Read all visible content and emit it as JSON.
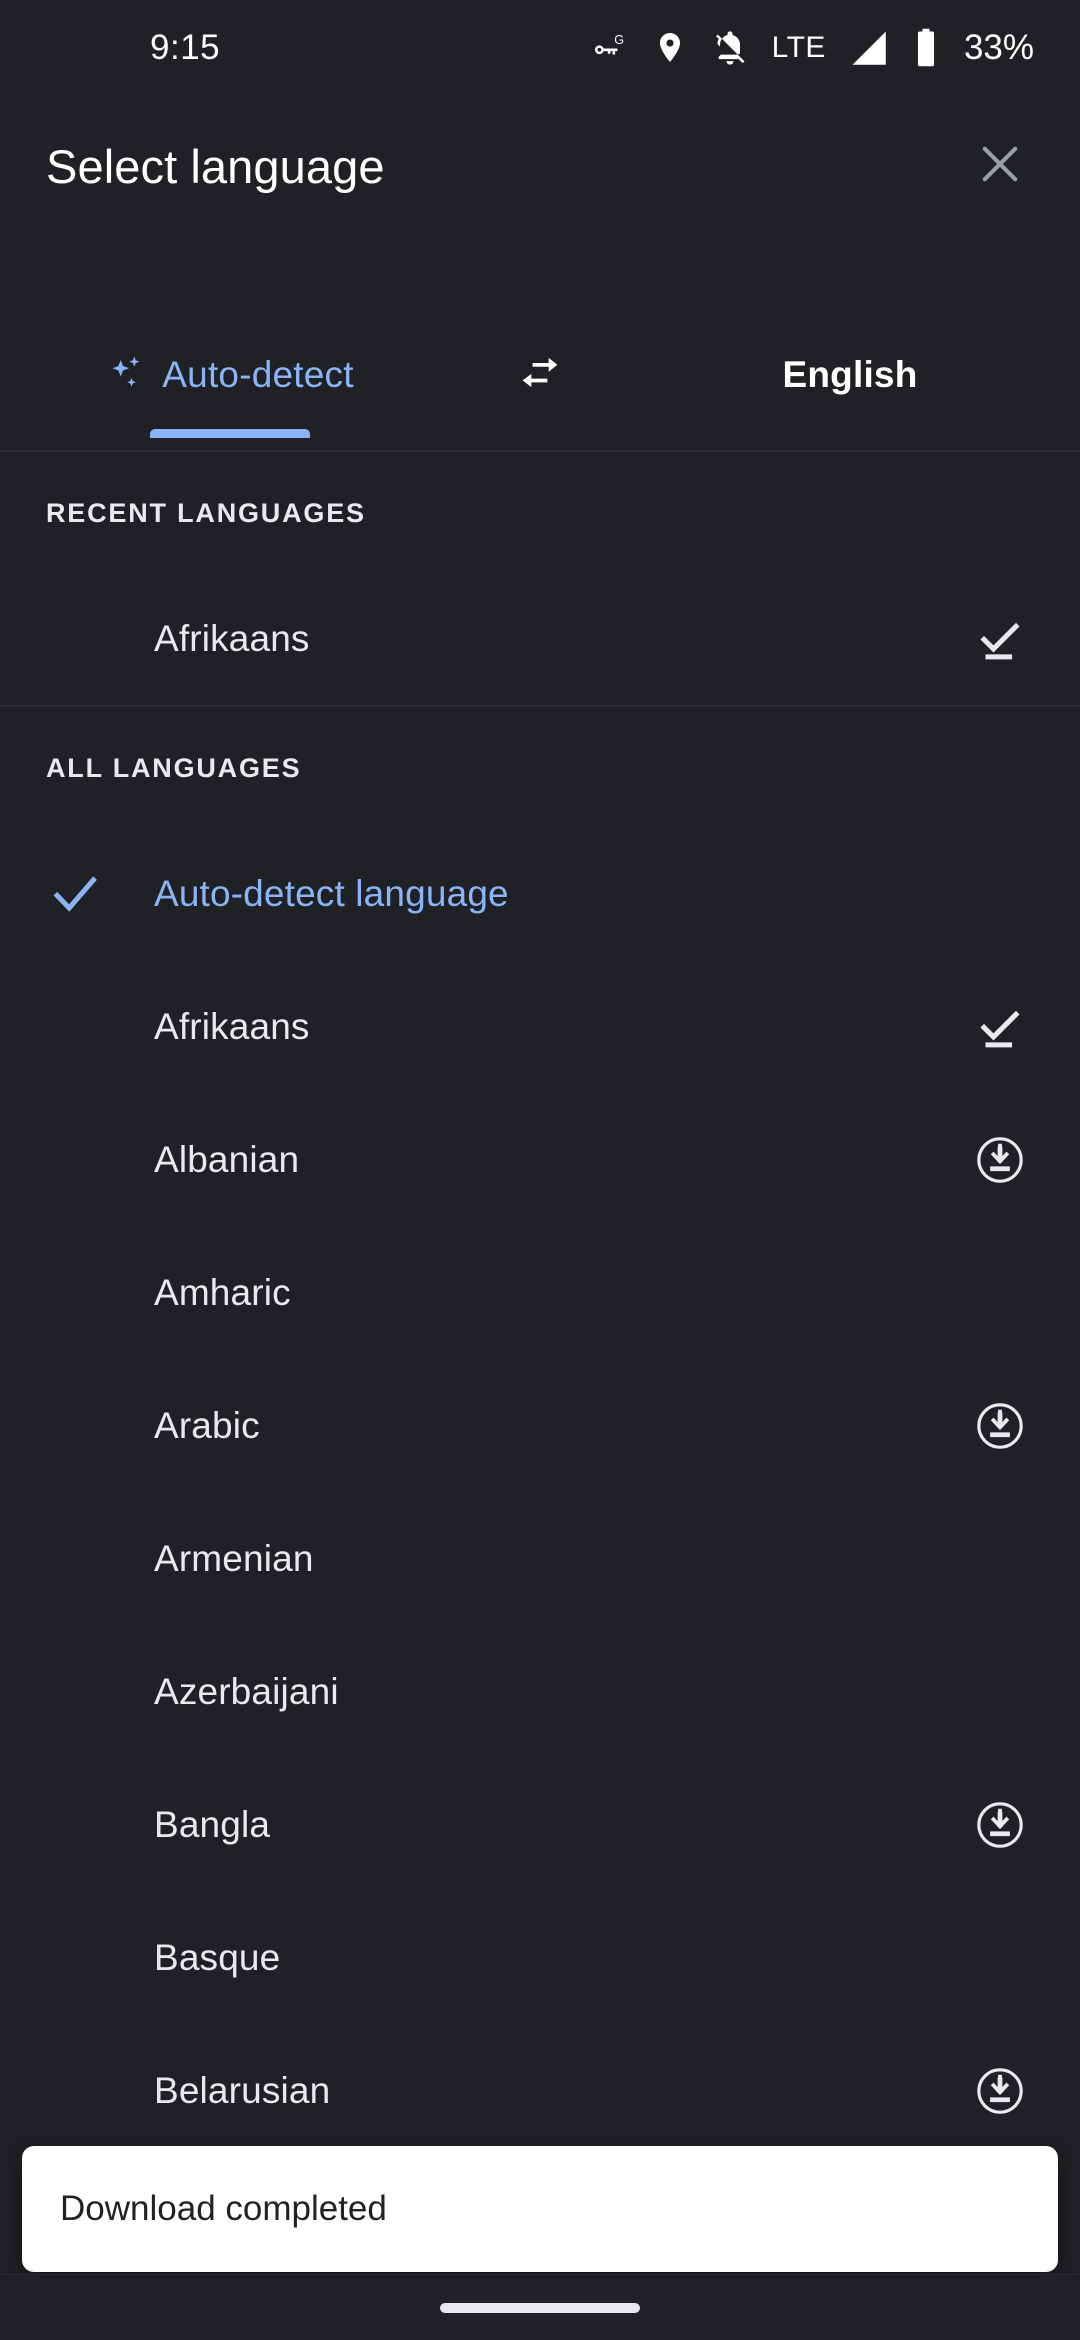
{
  "status_bar": {
    "time": "9:15",
    "battery_percent": "33%",
    "network_type": "LTE",
    "icons": [
      "vpn-key-icon",
      "location-pin-icon",
      "notifications-off-icon",
      "signal-icon",
      "battery-icon"
    ]
  },
  "app_bar": {
    "title": "Select language",
    "close_label": "×"
  },
  "tabs": {
    "source": {
      "label": "Auto-detect",
      "icon": "auto-awesome-sparkle-icon",
      "active": true
    },
    "swap": {
      "icon": "swap-horizontal-icon"
    },
    "target": {
      "label": "English",
      "active": false
    }
  },
  "sections": [
    {
      "header": "RECENT LANGUAGES",
      "items": [
        {
          "label": "Afrikaans",
          "selected": false,
          "action": "download-done-icon"
        }
      ]
    },
    {
      "header": "ALL LANGUAGES",
      "items": [
        {
          "label": "Auto-detect language",
          "selected": true,
          "action": "none"
        },
        {
          "label": "Afrikaans",
          "selected": false,
          "action": "download-done-icon"
        },
        {
          "label": "Albanian",
          "selected": false,
          "action": "download-circle-icon"
        },
        {
          "label": "Amharic",
          "selected": false,
          "action": "none"
        },
        {
          "label": "Arabic",
          "selected": false,
          "action": "download-circle-icon"
        },
        {
          "label": "Armenian",
          "selected": false,
          "action": "none"
        },
        {
          "label": "Azerbaijani",
          "selected": false,
          "action": "none"
        },
        {
          "label": "Bangla",
          "selected": false,
          "action": "download-circle-icon"
        },
        {
          "label": "Basque",
          "selected": false,
          "action": "none"
        },
        {
          "label": "Belarusian",
          "selected": false,
          "action": "download-circle-icon"
        }
      ]
    }
  ],
  "snackbar": {
    "message": "Download completed"
  },
  "colors": {
    "background": "#202124",
    "accent": "#8ab4f8",
    "text_primary": "#e8eaed",
    "snackbar_bg": "#ffffff",
    "snackbar_text": "#202124"
  }
}
